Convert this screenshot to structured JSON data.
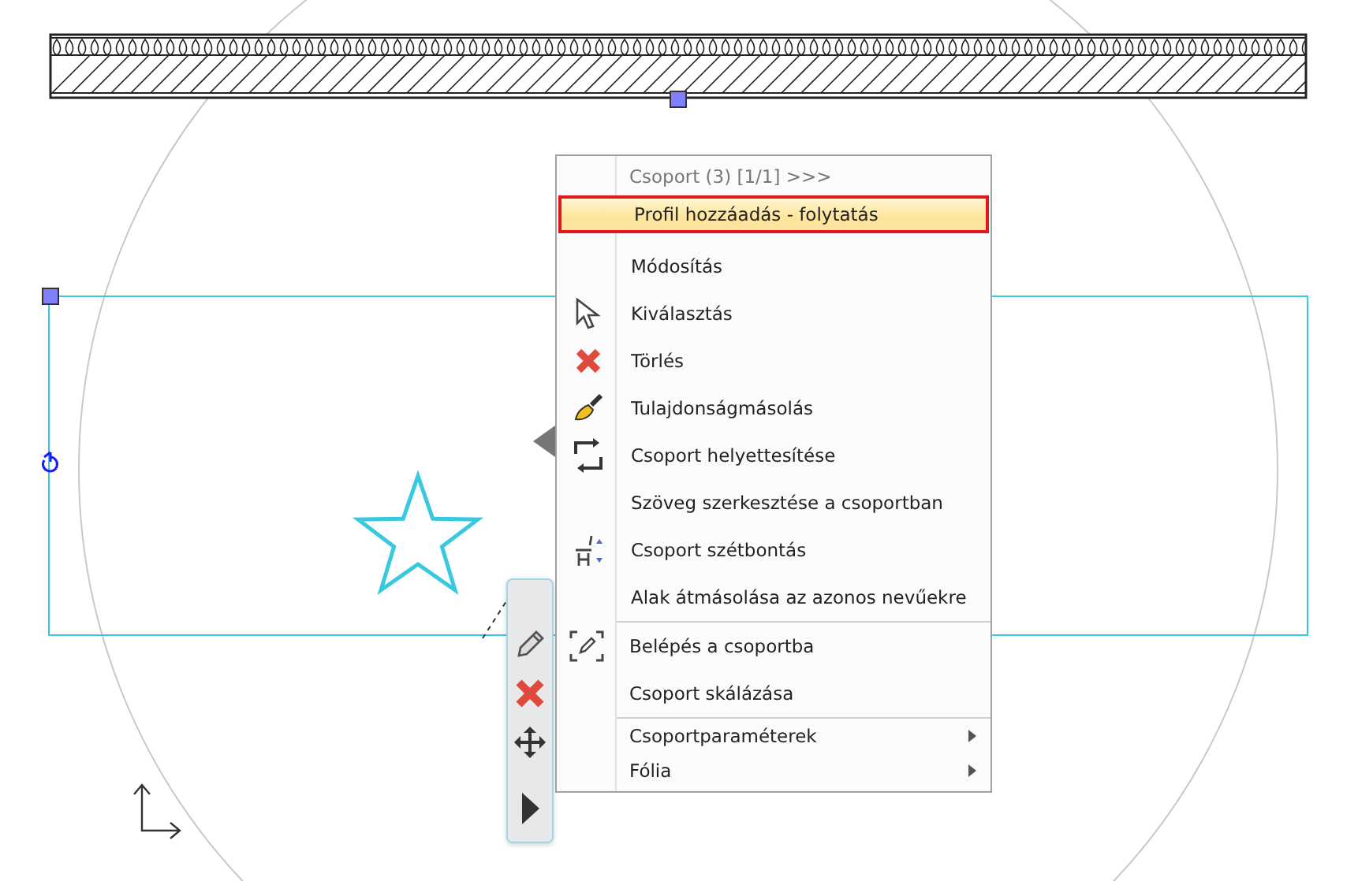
{
  "context_menu": {
    "header": "Csoport (3) [1/1] >>>",
    "sections": [
      [
        {
          "label": "Profil hozzáadás - folytatás",
          "selected": true,
          "submenu": false
        },
        {
          "label": "Módosítás",
          "selected": false,
          "submenu": false
        },
        {
          "label": "Kiválasztás",
          "selected": false,
          "submenu": false
        },
        {
          "label": "Törlés",
          "selected": false,
          "submenu": false
        },
        {
          "label": "Tulajdonságmásolás",
          "selected": false,
          "submenu": false
        },
        {
          "label": "Csoport helyettesítése",
          "selected": false,
          "submenu": false
        },
        {
          "label": "Szöveg szerkesztése a csoportban",
          "selected": false,
          "submenu": false
        },
        {
          "label": "Csoport szétbontás",
          "selected": false,
          "submenu": false
        },
        {
          "label": "Alak átmásolása az azonos nevűekre",
          "selected": false,
          "submenu": false
        }
      ],
      [
        {
          "label": "Belépés a csoportba",
          "selected": false,
          "submenu": false
        },
        {
          "label": "Csoport skálázása",
          "selected": false,
          "submenu": false
        }
      ],
      [
        {
          "label": "Csoportparaméterek",
          "selected": false,
          "submenu": true
        },
        {
          "label": "Fólia",
          "selected": false,
          "submenu": true
        }
      ]
    ]
  }
}
